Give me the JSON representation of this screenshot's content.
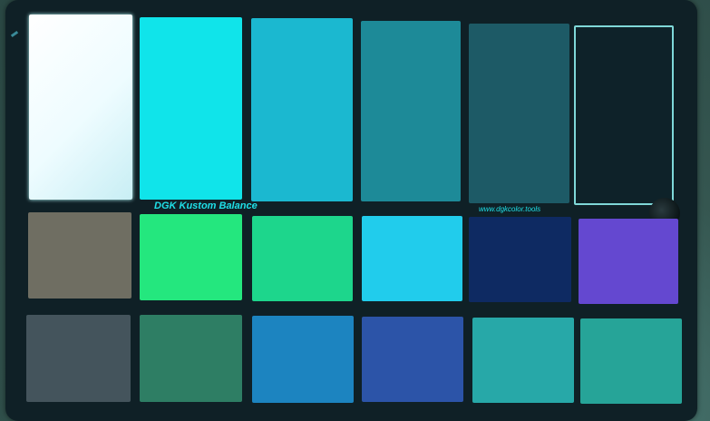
{
  "card": {
    "brand_label": "DGK Kustom Balance",
    "url_label": "www.dgkcolor.tools"
  },
  "patches": {
    "top_row": [
      "#ffffff",
      "#10e4ea",
      "#1bb8d0",
      "#1d8a98",
      "#1d5a66",
      "#0e2229"
    ],
    "middle_row": [
      "#6f6e62",
      "#24e77e",
      "#1dd68c",
      "#21ccec",
      "#0e2a62",
      "#6448d0"
    ],
    "bottom_row": [
      "#44545c",
      "#2e7e64",
      "#1c84c0",
      "#2c54a8",
      "#27a8a8",
      "#26a498"
    ]
  },
  "colors": {
    "label_text": "#1fe0e8",
    "card_body": "#0f2026",
    "background": "#3a5a58",
    "frame_outline": "#7fd8d8"
  }
}
